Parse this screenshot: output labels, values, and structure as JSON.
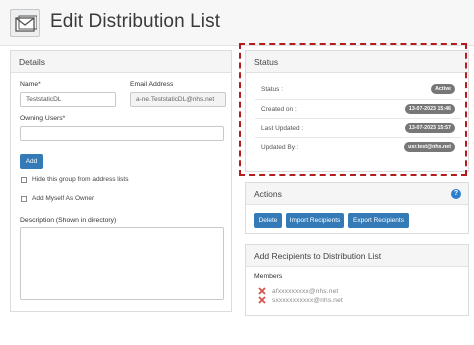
{
  "page": {
    "title": "Edit Distribution List"
  },
  "details": {
    "heading": "Details",
    "name_label": "Name*",
    "name_value": "TeststaticDL",
    "email_label": "Email Address",
    "email_value": "a-ne.TeststaticDL@nhs.net",
    "owning_users_label": "Owning Users*",
    "owning_users_value": "",
    "add_button": "Add",
    "hide_label": "Hide this group from address lists",
    "add_myself_label": "Add Myself As Owner",
    "description_label": "Description (Shown in directory)",
    "description_value": ""
  },
  "status": {
    "heading": "Status",
    "rows": [
      {
        "label": "Status :",
        "value": "Active"
      },
      {
        "label": "Created on :",
        "value": "13-07-2023 15:46"
      },
      {
        "label": "Last Updated :",
        "value": "13-07-2023 15:57"
      },
      {
        "label": "Updated By :",
        "value": "usr.test@nhs.net"
      }
    ],
    "badge_color": "#777777",
    "highlight_color": "#b31d1d"
  },
  "actions": {
    "heading": "Actions",
    "help_glyph": "?",
    "buttons": {
      "delete": "Delete",
      "import": "Import Recipients",
      "export": "Export Recipients"
    },
    "button_color": "#337ab7"
  },
  "recipients": {
    "heading": "Add Recipients to Distribution List",
    "members_label": "Members",
    "members": [
      {
        "email": "afxxxxxxxxx@nhs.net"
      },
      {
        "email": "sxxxxxxxxxxx@nhs.net"
      }
    ]
  },
  "icons": {
    "header": "envelope-icon",
    "remove": "remove-x-icon",
    "help": "help-icon"
  }
}
